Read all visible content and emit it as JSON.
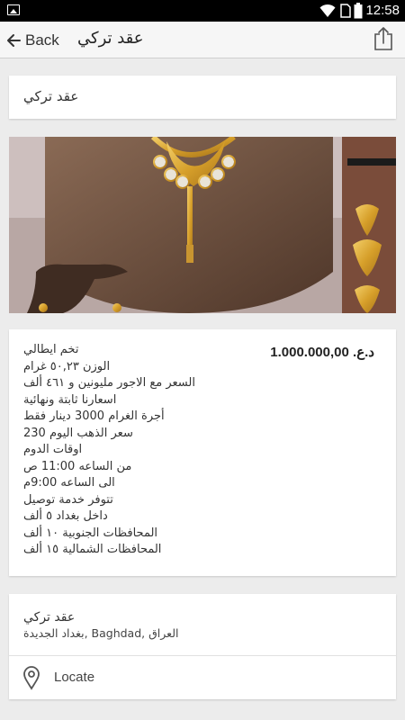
{
  "status_bar": {
    "time": "12:58"
  },
  "app_bar": {
    "back_label": "Back",
    "title": "عقد تركي"
  },
  "listing": {
    "title": "عقد تركي",
    "price": "د.ع. 1.000.000,00",
    "description": [
      "تخم ايطالي",
      "الوزن ٥٠,٢٣ غرام",
      "السعر مع الاجور مليونين و ٤٦١ ألف",
      "اسعارنا ثابتة ونهائية",
      "أجرة الغرام 3000 دينار فقط",
      "سعر الذهب اليوم 230",
      "اوقات الدوم",
      "من الساعه 11:00 ص",
      "الى الساعه 9:00م",
      "تتوفر خدمة توصيل",
      "داخل بغداد ٥ ألف",
      "المحافظات الجنوبية ١٠ ألف",
      "المحافظات الشمالية ١٥ ألف"
    ]
  },
  "location": {
    "title": "عقد تركي",
    "address": "العراق ,Baghdad ,بغداد الجديدة",
    "locate_label": "Locate"
  },
  "colors": {
    "app_bar_bg": "#f6f6f6",
    "page_bg": "#ececec",
    "card_bg": "#ffffff",
    "gold": "#d9a632"
  },
  "icons": {
    "back": "arrow-left-icon",
    "share": "share-icon",
    "locate": "map-pin-icon"
  }
}
